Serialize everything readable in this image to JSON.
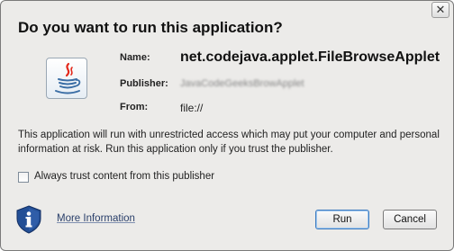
{
  "dialog": {
    "heading": "Do you want to run this application?",
    "close_glyph": "✕"
  },
  "details": {
    "name_label": "Name:",
    "name_value": "net.codejava.applet.FileBrowseApplet",
    "publisher_label": "Publisher:",
    "publisher_value": "JavaCodeGeeksBrowApplet",
    "from_label": "From:",
    "from_value": "file://"
  },
  "warning_text": "This application will run with unrestricted access which may put your computer and personal information at risk. Run this application only if you trust the publisher.",
  "trust": {
    "label": "Always trust content from this publisher",
    "checked": false
  },
  "footer": {
    "more_info_label": "More Information",
    "run_label": "Run",
    "cancel_label": "Cancel"
  },
  "icons": {
    "app_icon": "java-coffee-cup-icon",
    "info_icon": "shield-info-icon"
  },
  "colors": {
    "dialog_bg": "#ecebe9",
    "link": "#2a3f6a",
    "java_red": "#e3291b",
    "java_blue": "#3b6ea5",
    "shield_blue": "#234f96"
  }
}
